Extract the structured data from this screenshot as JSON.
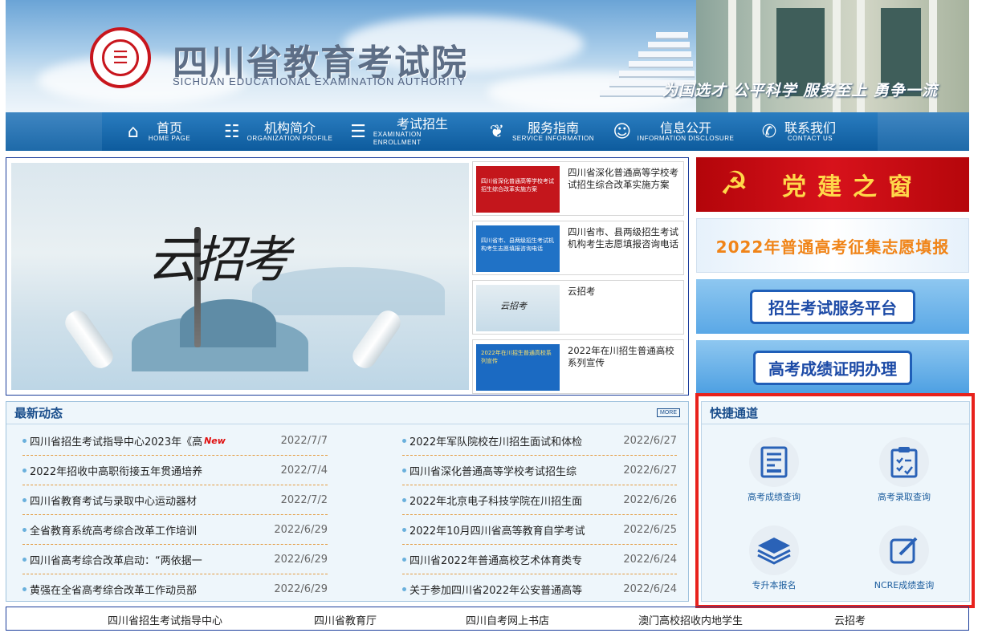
{
  "header": {
    "logo_text": "四川省教育考试院",
    "title": "四川省教育考试院",
    "subtitle": "SICHUAN EDUCATIONAL EXAMINATION AUTHORITY",
    "slogan": "为国选才 公平科学 服务至上 勇争一流"
  },
  "nav": [
    {
      "cn": "首页",
      "en": "HOME PAGE",
      "icon": "home-icon"
    },
    {
      "cn": "机构简介",
      "en": "ORGANIZATION PROFILE",
      "icon": "org-chart-icon"
    },
    {
      "cn": "考试招生",
      "en": "EXAMINATION ENROLLMENT",
      "icon": "document-icon"
    },
    {
      "cn": "服务指南",
      "en": "SERVICE INFORMATION",
      "icon": "handshake-icon"
    },
    {
      "cn": "信息公开",
      "en": "INFORMATION DISCLOSURE",
      "icon": "people-icon"
    },
    {
      "cn": "联系我们",
      "en": "CONTACT US",
      "icon": "contact-icon"
    }
  ],
  "hero": {
    "title": "云招考"
  },
  "cards": [
    {
      "text": "四川省深化普通高等学校考试招生综合改革实施方案",
      "thumb_text": "四川省深化普通高等学校考试招生综合改革实施方案",
      "thumb_color": "#c4161c"
    },
    {
      "text": "四川省市、县两级招生考试机构考生志愿填报咨询电话",
      "thumb_text": "四川省市、县两级招生考试机构考生志愿填报咨询电话",
      "thumb_color": "#2072c6"
    },
    {
      "text": "云招考",
      "thumb_text": "云招考",
      "thumb_color": "#cfe0ea"
    },
    {
      "text": "2022年在川招生普通高校系列宣传",
      "thumb_text": "2022年在川招生普通高校系列宣传",
      "thumb_color": "#1b6ac2"
    }
  ],
  "right_banners": {
    "party": "党建之窗",
    "volunteer": "2022年普通高考征集志愿填报",
    "platform": "招生考试服务平台",
    "certificate": "高考成绩证明办理"
  },
  "latest_news": {
    "title": "最新动态",
    "more": "MORE",
    "new_label": "New",
    "left": [
      {
        "title": "四川省招生考试指导中心2023年《高",
        "date": "2022/7/7",
        "is_new": true
      },
      {
        "title": "2022年招收中高职衔接五年贯通培养",
        "date": "2022/7/4"
      },
      {
        "title": "四川省教育考试与录取中心运动器材",
        "date": "2022/7/2"
      },
      {
        "title": "全省教育系统高考综合改革工作培训",
        "date": "2022/6/29"
      },
      {
        "title": "四川省高考综合改革启动：“两依据一",
        "date": "2022/6/29"
      },
      {
        "title": "黄强在全省高考综合改革工作动员部",
        "date": "2022/6/29"
      }
    ],
    "right": [
      {
        "title": "2022年军队院校在川招生面试和体检",
        "date": "2022/6/27"
      },
      {
        "title": "四川省深化普通高等学校考试招生综",
        "date": "2022/6/27"
      },
      {
        "title": "2022年北京电子科技学院在川招生面",
        "date": "2022/6/26"
      },
      {
        "title": "2022年10月四川省高等教育自学考试",
        "date": "2022/6/25"
      },
      {
        "title": "四川省2022年普通高校艺术体育类专",
        "date": "2022/6/24"
      },
      {
        "title": "关于参加四川省2022年公安普通高等",
        "date": "2022/6/24"
      }
    ]
  },
  "quick_access": {
    "title": "快捷通道",
    "items": [
      {
        "label": "高考成绩查询",
        "icon": "score-report-icon"
      },
      {
        "label": "高考录取查询",
        "icon": "clipboard-check-icon"
      },
      {
        "label": "专升本报名",
        "icon": "layers-icon"
      },
      {
        "label": "NCRE成绩查询",
        "icon": "edit-icon"
      }
    ]
  },
  "links": [
    "四川省招生考试指导中心",
    "四川省教育厅",
    "四川自考网上书店",
    "澳门高校招收内地学生",
    "云招考"
  ],
  "colors": {
    "nav": "#1e6aa9",
    "accent_red": "#e8221c",
    "title_blue": "#1a4e8c",
    "quick_blue": "#1c5d9e"
  }
}
